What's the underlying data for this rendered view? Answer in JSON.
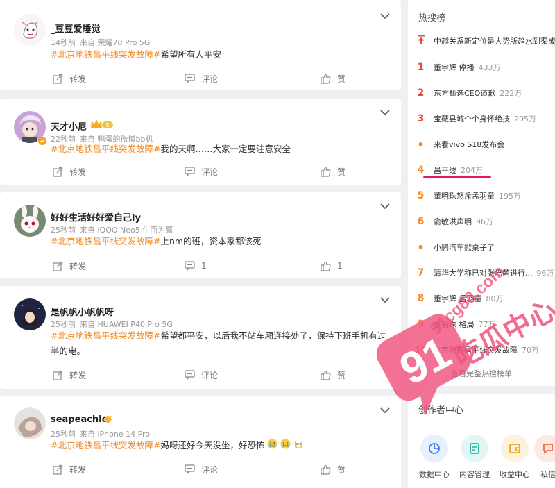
{
  "posts": [
    {
      "name": "_豆豆爱睡觉",
      "time": "14秒前",
      "from": "来自 荣耀70 Pro 5G",
      "topic": "#北京地铁昌平线突发故障#",
      "text": "希望所有人平安",
      "forward": "转发",
      "comment": "评论",
      "like": "赞"
    },
    {
      "name": "天才小尼",
      "time": "22秒前",
      "from": "来自 鸭蛋的微博bb机",
      "topic": "#北京地铁昌平线突发故障#",
      "text": "我的天啊……大家一定要注意安全",
      "forward": "转发",
      "comment": "评论",
      "like": "赞"
    },
    {
      "name": "好好生活好好爱自己ly",
      "time": "25秒前",
      "from": "来自 iQOO Neo5 生而为赢",
      "topic": "#北京地铁昌平线突发故障#",
      "text": "上nm的班，资本家都该死",
      "forward": "转发",
      "comment": "1",
      "like": "1"
    },
    {
      "name": "是帆帆小帆帆呀",
      "time": "25秒前",
      "from": "来自 HUAWEI P40 Pro 5G",
      "topic": "#北京地铁昌平线突发故障#",
      "text": "希望都平安，以后我不站车厢连接处了，保持下班手机有过半的电。",
      "forward": "转发",
      "comment": "评论",
      "like": "赞"
    },
    {
      "name": "seapeachlo",
      "time": "25秒前",
      "from": "来自 iPhone 14 Pro",
      "topic": "#北京地铁昌平线突发故障#",
      "text": "妈呀还好今天没坐，好恐怖",
      "forward": "转发",
      "comment": "评论",
      "like": "赞"
    }
  ],
  "hot": {
    "title": "热搜榜",
    "items": [
      {
        "rank": "",
        "text": "中越关系新定位是大势所趋水到渠成",
        "heat": ""
      },
      {
        "rank": "1",
        "text": "董宇辉 停播",
        "heat": "433万"
      },
      {
        "rank": "2",
        "text": "东方甄选CEO道歉",
        "heat": "222万"
      },
      {
        "rank": "3",
        "text": "宝藏县城个个身怀绝技",
        "heat": "205万"
      },
      {
        "rank": "•",
        "text": "来看vivo S18发布会",
        "heat": ""
      },
      {
        "rank": "4",
        "text": "昌平线",
        "heat": "204万"
      },
      {
        "rank": "5",
        "text": "董明珠怒斥孟羽童",
        "heat": "195万"
      },
      {
        "rank": "6",
        "text": "俞敏洪声明",
        "heat": "96万"
      },
      {
        "rank": "•",
        "text": "小鹏汽车掀桌子了",
        "heat": ""
      },
      {
        "rank": "7",
        "text": "清华大学称已对张培萌进行...",
        "heat": "96万"
      },
      {
        "rank": "8",
        "text": "董宇辉 孟羽童",
        "heat": "80万"
      },
      {
        "rank": "9",
        "text": "董明珠 格局",
        "heat": "77万"
      },
      {
        "rank": "10",
        "text": "北京地铁昌平线突发故障",
        "heat": "70万"
      }
    ],
    "more": "查看完整热搜榜单"
  },
  "creator": {
    "title": "创作者中心",
    "items": [
      {
        "label": "数据中心",
        "color": "#3d7ff0",
        "bg": "#e8f0fe",
        "icon": "pie-chart-icon"
      },
      {
        "label": "内容管理",
        "color": "#1fb5a6",
        "bg": "#e3f6f4",
        "icon": "document-icon"
      },
      {
        "label": "收益中心",
        "color": "#f2a31b",
        "bg": "#fdf2de",
        "icon": "wallet-icon"
      },
      {
        "label": "私信",
        "color": "#e96a3a",
        "bg": "#fde9e2",
        "icon": "message-icon"
      }
    ]
  },
  "watermark": {
    "site": "91cg88.com",
    "logo": "91",
    "text": "吃瓜中心",
    "color": "#f0527e"
  }
}
